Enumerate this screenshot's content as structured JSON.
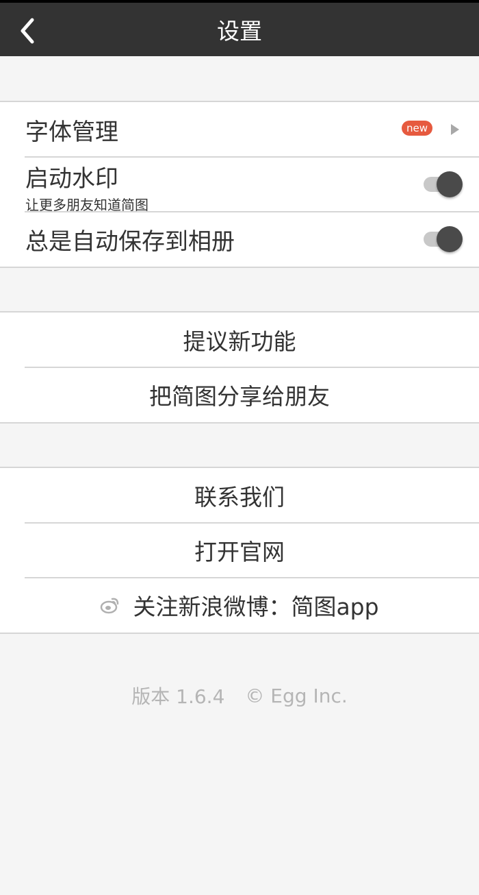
{
  "header": {
    "title": "设置",
    "back_icon": "chevron-left-icon"
  },
  "settings_group": {
    "items": [
      {
        "label": "字体管理",
        "badge": "new",
        "trailing_icon": "play-right-icon"
      },
      {
        "label": "启动水印",
        "sublabel": "让更多朋友知道简图",
        "toggle_on": true
      },
      {
        "label": "总是自动保存到相册",
        "toggle_on": true
      }
    ]
  },
  "feedback_group": {
    "items": [
      {
        "label": "提议新功能"
      },
      {
        "label": "把简图分享给朋友"
      }
    ]
  },
  "contact_group": {
    "items": [
      {
        "label": "联系我们"
      },
      {
        "label": "打开官网"
      },
      {
        "label": "关注新浪微博：简图app",
        "icon": "weibo-icon"
      }
    ]
  },
  "footer": {
    "version": "版本 1.6.4",
    "copyright": "© Egg Inc."
  },
  "colors": {
    "header_bg": "#333333",
    "badge_bg": "#e65a3f",
    "toggle_knob": "#4a4a4a",
    "background": "#f5f5f5"
  }
}
